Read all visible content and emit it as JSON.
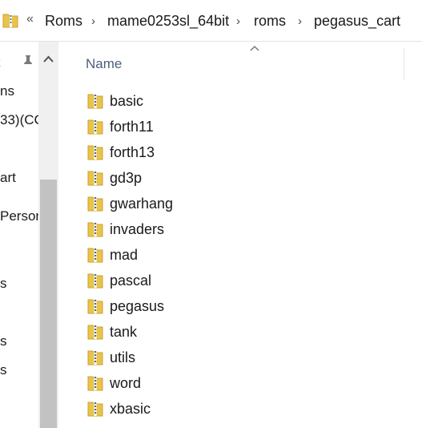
{
  "address": {
    "overflow": "«",
    "crumbs": [
      "Roms",
      "mame0253sl_64bit",
      "roms",
      "pegasus_cart"
    ],
    "separator": "›"
  },
  "nav": {
    "items": [
      "ns",
      "33)(CC",
      "art",
      "Person",
      "s",
      "s",
      "s"
    ]
  },
  "column": {
    "name_header": "Name"
  },
  "files": [
    "basic",
    "forth11",
    "forth13",
    "gd3p",
    "gwarhang",
    "invaders",
    "mad",
    "pascal",
    "pegasus",
    "tank",
    "utils",
    "word",
    "xbasic"
  ],
  "colors": {
    "folder_yellow": "#e9c44b",
    "zip_stripe": "#4d6b8c",
    "header_text": "#4c607a",
    "scroll_thumb": "#c2c2c2"
  },
  "icons": {
    "address_icon": "folder-zip-icon",
    "pin": "pin-icon",
    "scroll_up": "chevron-up-icon",
    "sort": "sort-ascending-icon",
    "file": "zip-folder-icon"
  }
}
